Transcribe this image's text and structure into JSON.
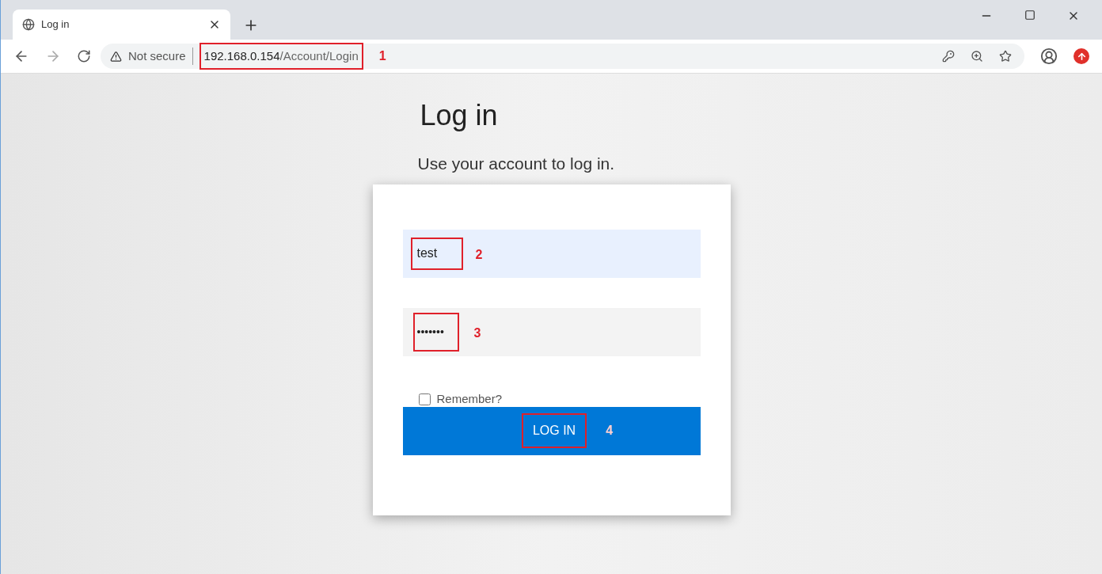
{
  "browser": {
    "tab": {
      "title": "Log in",
      "selected": true
    },
    "address": {
      "security": "Not secure",
      "url_host": "192.168.0.154",
      "url_path": "/Account/Login"
    }
  },
  "page": {
    "title": "Log in",
    "subtitle": "Use your account to log in.",
    "username": {
      "value": "test"
    },
    "password": {
      "value": "•••••••"
    },
    "remember": {
      "label": "Remember?",
      "checked": false
    },
    "submit": "LOG IN"
  },
  "annotations": [
    "1",
    "2",
    "3",
    "4"
  ]
}
